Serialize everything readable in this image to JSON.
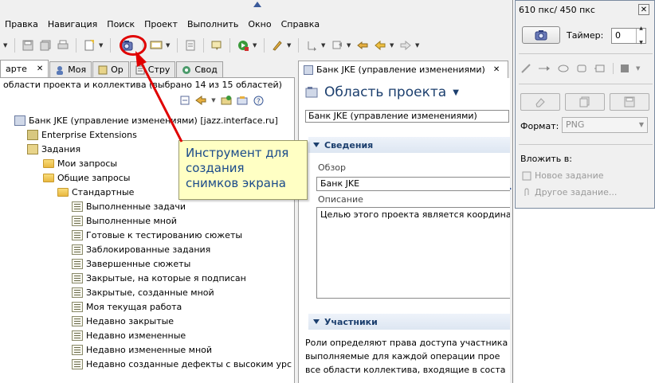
{
  "menubar": {
    "items": [
      "Правка",
      "Навигация",
      "Поиск",
      "Проект",
      "Выполнить",
      "Окно",
      "Справка"
    ]
  },
  "toolbar": {
    "icons": [
      "save-icon",
      "save-all-icon",
      "print-icon",
      "new-icon",
      "camera-icon",
      "screen-icon",
      "doc-icon",
      "lamp-icon",
      "run-icon",
      "pen-icon",
      "back-icon",
      "forward-icon"
    ]
  },
  "left_tabs": [
    {
      "label": "арте",
      "active": true
    },
    {
      "label": "Моя",
      "active": false
    },
    {
      "label": "Ор",
      "active": false
    },
    {
      "label": "Стру",
      "active": false
    },
    {
      "label": "Свод",
      "active": false
    }
  ],
  "filter": {
    "text": "области проекта и коллектива (выбрано 14 из 15 областей)"
  },
  "tree": {
    "root": "Банк JKE (управление изменениями) [jazz.interface.ru]",
    "enterprise": "Enterprise Extensions",
    "tasks": "Задания",
    "my_queries": "Мои запросы",
    "shared_queries": "Общие запросы",
    "standard": "Стандартные",
    "queries": [
      "Выполненные задачи",
      "Выполненные мной",
      "Готовые к тестированию сюжеты",
      "Заблокированные задания",
      "Завершенные сюжеты",
      "Закрытые, на которые я подписан",
      "Закрытые, созданные мной",
      "Моя текущая работа",
      "Недавно закрытые",
      "Недавно измененные",
      "Недавно измененные мной",
      "Недавно созданные дефекты с высоким урс"
    ]
  },
  "editor": {
    "tab_label": "Банк JKE (управление изменениями)",
    "title": "Область проекта",
    "combo": "Банк JKE (управление изменениями)",
    "section_details": "Сведения",
    "overview_label": "Обзор",
    "overview_value": "Банк JKE",
    "description_label": "Описание",
    "description_value": "Целью этого проекта является координа",
    "section_members": "Участники",
    "roles_lines": [
      "Роли определяют права доступа участника",
      "выполняемые для каждой операции прое",
      "все области коллектива, входящие в соста"
    ]
  },
  "callout": {
    "text": "Инструмент для создания снимков экрана"
  },
  "screenshot_tool": {
    "title": "610 пкс/ 450 пкс",
    "timer_label": "Таймер:",
    "timer_value": "0",
    "format_label": "Формат:",
    "format_value": "PNG",
    "attach_label": "Вложить в:",
    "attach_new": "Новое задание",
    "attach_other": "Другое задание..."
  },
  "colors": {
    "highlight_red": "#e00000",
    "title_blue": "#1c3f6e",
    "callout_bg": "#ffffc4",
    "callout_text": "#1a4a8a"
  }
}
